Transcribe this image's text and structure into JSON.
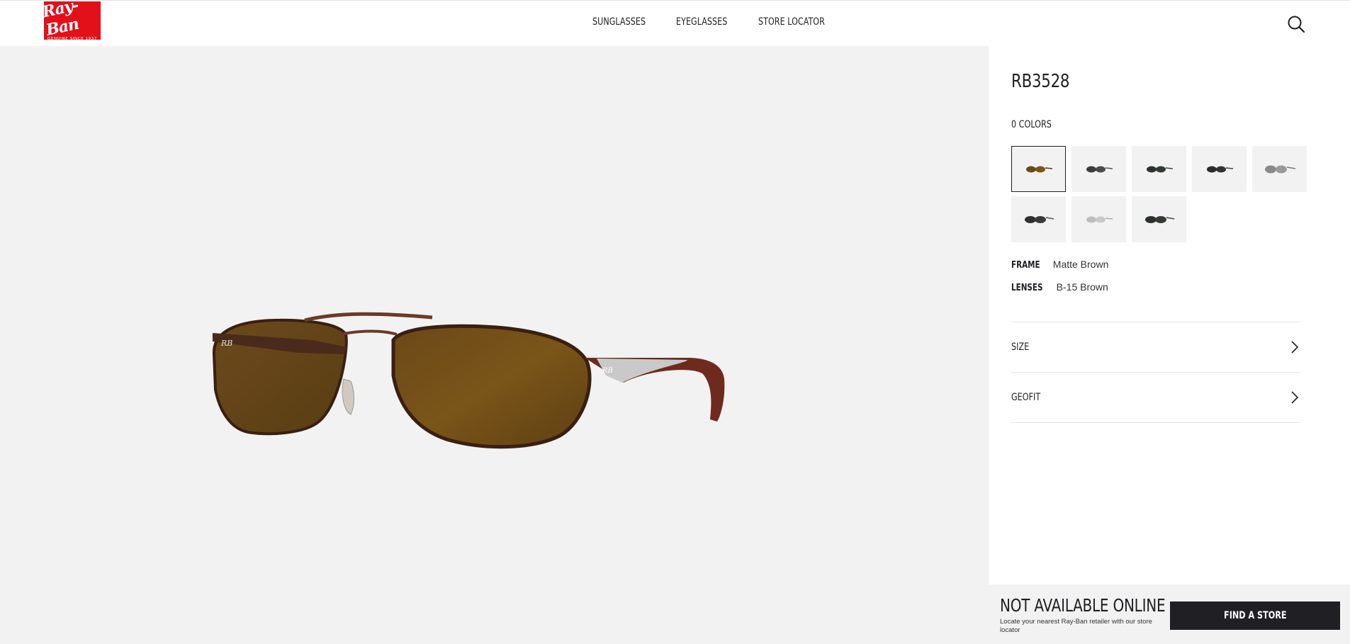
{
  "brand": {
    "logo_script": "Ray-Ban",
    "logo_tagline": "GENUINE SINCE 1937",
    "color": "#e3101a"
  },
  "nav": {
    "items": [
      {
        "label": "SUNGLASSES"
      },
      {
        "label": "EYEGLASSES"
      },
      {
        "label": "STORE LOCATOR"
      }
    ],
    "search_icon": "search-icon"
  },
  "product": {
    "model": "RB3528",
    "colors_label": "0 COLORS",
    "swatches": [
      {
        "name": "matte-brown",
        "selected": true
      },
      {
        "name": "gunmetal-grey",
        "selected": false
      },
      {
        "name": "black-green",
        "selected": false
      },
      {
        "name": "black-grey",
        "selected": false
      },
      {
        "name": "silver-mirror",
        "selected": false
      },
      {
        "name": "black-dark-grey",
        "selected": false
      },
      {
        "name": "silver-light",
        "selected": false
      },
      {
        "name": "black-green-2",
        "selected": false
      }
    ],
    "frame_label": "FRAME",
    "frame_value": "Matte Brown",
    "lenses_label": "LENSES",
    "lenses_value": "B-15 Brown"
  },
  "accordions": {
    "size_label": "SIZE",
    "geofit_label": "GEOFIT"
  },
  "availability": {
    "title": "NOT AVAILABLE ONLINE",
    "subtitle": "Locate your nearest Ray-Ban retailer with our store locator",
    "button_label": "FIND A STORE"
  },
  "colors": {
    "stage_bg": "#f2f2f2",
    "button_bg": "#1f1f24",
    "text": "#1f1f24"
  }
}
